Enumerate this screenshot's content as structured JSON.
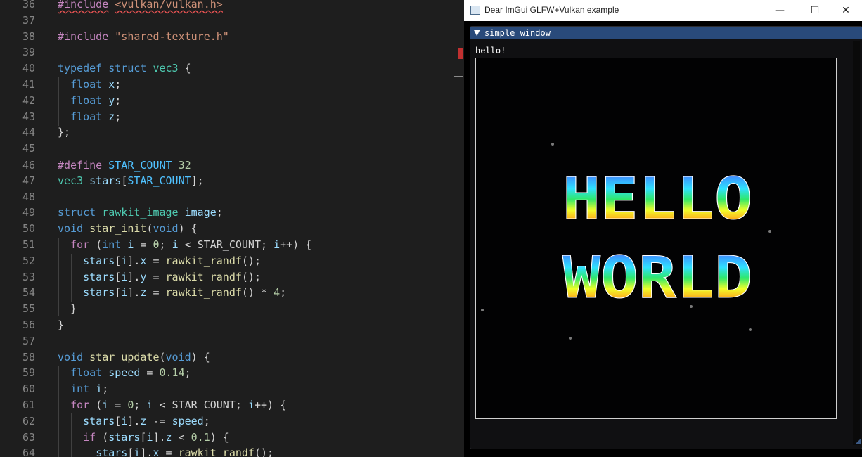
{
  "editor": {
    "lines": [
      {
        "num": "36",
        "tokens": [
          {
            "t": "#include",
            "c": "t-pp squig"
          },
          {
            "t": " ",
            "c": "t-plain"
          },
          {
            "t": "<vulkan/vulkan.h>",
            "c": "t-str squig"
          }
        ]
      },
      {
        "num": "37",
        "tokens": []
      },
      {
        "num": "38",
        "tokens": [
          {
            "t": "#include",
            "c": "t-pp"
          },
          {
            "t": " ",
            "c": "t-plain"
          },
          {
            "t": "\"shared-texture.h\"",
            "c": "t-str"
          }
        ]
      },
      {
        "num": "39",
        "tokens": []
      },
      {
        "num": "40",
        "tokens": [
          {
            "t": "typedef",
            "c": "t-kw"
          },
          {
            "t": " ",
            "c": "t-plain"
          },
          {
            "t": "struct",
            "c": "t-kw"
          },
          {
            "t": " ",
            "c": "t-plain"
          },
          {
            "t": "vec3",
            "c": "t-ty"
          },
          {
            "t": " {",
            "c": "t-plain"
          }
        ]
      },
      {
        "num": "41",
        "tokens": [
          {
            "t": "  ",
            "c": "t-plain"
          },
          {
            "t": "float",
            "c": "t-kw"
          },
          {
            "t": " ",
            "c": "t-plain"
          },
          {
            "t": "x",
            "c": "t-id"
          },
          {
            "t": ";",
            "c": "t-plain"
          }
        ]
      },
      {
        "num": "42",
        "tokens": [
          {
            "t": "  ",
            "c": "t-plain"
          },
          {
            "t": "float",
            "c": "t-kw"
          },
          {
            "t": " ",
            "c": "t-plain"
          },
          {
            "t": "y",
            "c": "t-id"
          },
          {
            "t": ";",
            "c": "t-plain"
          }
        ]
      },
      {
        "num": "43",
        "tokens": [
          {
            "t": "  ",
            "c": "t-plain"
          },
          {
            "t": "float",
            "c": "t-kw"
          },
          {
            "t": " ",
            "c": "t-plain"
          },
          {
            "t": "z",
            "c": "t-id"
          },
          {
            "t": ";",
            "c": "t-plain"
          }
        ]
      },
      {
        "num": "44",
        "tokens": [
          {
            "t": "};",
            "c": "t-plain"
          }
        ]
      },
      {
        "num": "45",
        "tokens": []
      },
      {
        "num": "46",
        "tokens": [
          {
            "t": "#define",
            "c": "t-pp"
          },
          {
            "t": " ",
            "c": "t-plain"
          },
          {
            "t": "STAR_COUNT",
            "c": "t-mac"
          },
          {
            "t": " ",
            "c": "t-plain"
          },
          {
            "t": "32",
            "c": "t-num"
          }
        ]
      },
      {
        "num": "47",
        "tokens": [
          {
            "t": "vec3",
            "c": "t-ty"
          },
          {
            "t": " ",
            "c": "t-plain"
          },
          {
            "t": "stars",
            "c": "t-id"
          },
          {
            "t": "[",
            "c": "t-plain"
          },
          {
            "t": "STAR_COUNT",
            "c": "t-mac"
          },
          {
            "t": "];",
            "c": "t-plain"
          }
        ]
      },
      {
        "num": "48",
        "tokens": []
      },
      {
        "num": "49",
        "tokens": [
          {
            "t": "struct",
            "c": "t-kw"
          },
          {
            "t": " ",
            "c": "t-plain"
          },
          {
            "t": "rawkit_image",
            "c": "t-ty"
          },
          {
            "t": " ",
            "c": "t-plain"
          },
          {
            "t": "image",
            "c": "t-id"
          },
          {
            "t": ";",
            "c": "t-plain"
          }
        ]
      },
      {
        "num": "50",
        "tokens": [
          {
            "t": "void",
            "c": "t-kw"
          },
          {
            "t": " ",
            "c": "t-plain"
          },
          {
            "t": "star_init",
            "c": "t-fn"
          },
          {
            "t": "(",
            "c": "t-plain"
          },
          {
            "t": "void",
            "c": "t-kw"
          },
          {
            "t": ") {",
            "c": "t-plain"
          }
        ]
      },
      {
        "num": "51",
        "tokens": [
          {
            "t": "  ",
            "c": "t-plain"
          },
          {
            "t": "for",
            "c": "t-pp"
          },
          {
            "t": " (",
            "c": "t-plain"
          },
          {
            "t": "int",
            "c": "t-kw"
          },
          {
            "t": " ",
            "c": "t-plain"
          },
          {
            "t": "i",
            "c": "t-id"
          },
          {
            "t": " = ",
            "c": "t-plain"
          },
          {
            "t": "0",
            "c": "t-num"
          },
          {
            "t": "; ",
            "c": "t-plain"
          },
          {
            "t": "i",
            "c": "t-id"
          },
          {
            "t": " < ",
            "c": "t-plain"
          },
          {
            "t": "STAR_COUNT",
            "c": "t-plain"
          },
          {
            "t": "; ",
            "c": "t-plain"
          },
          {
            "t": "i",
            "c": "t-id"
          },
          {
            "t": "++) {",
            "c": "t-plain"
          }
        ]
      },
      {
        "num": "52",
        "tokens": [
          {
            "t": "    ",
            "c": "t-plain"
          },
          {
            "t": "stars",
            "c": "t-id"
          },
          {
            "t": "[",
            "c": "t-plain"
          },
          {
            "t": "i",
            "c": "t-id"
          },
          {
            "t": "].",
            "c": "t-plain"
          },
          {
            "t": "x",
            "c": "t-id"
          },
          {
            "t": " = ",
            "c": "t-plain"
          },
          {
            "t": "rawkit_randf",
            "c": "t-fn"
          },
          {
            "t": "();",
            "c": "t-plain"
          }
        ]
      },
      {
        "num": "53",
        "tokens": [
          {
            "t": "    ",
            "c": "t-plain"
          },
          {
            "t": "stars",
            "c": "t-id"
          },
          {
            "t": "[",
            "c": "t-plain"
          },
          {
            "t": "i",
            "c": "t-id"
          },
          {
            "t": "].",
            "c": "t-plain"
          },
          {
            "t": "y",
            "c": "t-id"
          },
          {
            "t": " = ",
            "c": "t-plain"
          },
          {
            "t": "rawkit_randf",
            "c": "t-fn"
          },
          {
            "t": "();",
            "c": "t-plain"
          }
        ]
      },
      {
        "num": "54",
        "tokens": [
          {
            "t": "    ",
            "c": "t-plain"
          },
          {
            "t": "stars",
            "c": "t-id"
          },
          {
            "t": "[",
            "c": "t-plain"
          },
          {
            "t": "i",
            "c": "t-id"
          },
          {
            "t": "].",
            "c": "t-plain"
          },
          {
            "t": "z",
            "c": "t-id"
          },
          {
            "t": " = ",
            "c": "t-plain"
          },
          {
            "t": "rawkit_randf",
            "c": "t-fn"
          },
          {
            "t": "() * ",
            "c": "t-plain"
          },
          {
            "t": "4",
            "c": "t-num"
          },
          {
            "t": ";",
            "c": "t-plain"
          }
        ]
      },
      {
        "num": "55",
        "tokens": [
          {
            "t": "  }",
            "c": "t-plain"
          }
        ]
      },
      {
        "num": "56",
        "tokens": [
          {
            "t": "}",
            "c": "t-plain"
          }
        ]
      },
      {
        "num": "57",
        "tokens": []
      },
      {
        "num": "58",
        "tokens": [
          {
            "t": "void",
            "c": "t-kw"
          },
          {
            "t": " ",
            "c": "t-plain"
          },
          {
            "t": "star_update",
            "c": "t-fn"
          },
          {
            "t": "(",
            "c": "t-plain"
          },
          {
            "t": "void",
            "c": "t-kw"
          },
          {
            "t": ") {",
            "c": "t-plain"
          }
        ]
      },
      {
        "num": "59",
        "tokens": [
          {
            "t": "  ",
            "c": "t-plain"
          },
          {
            "t": "float",
            "c": "t-kw"
          },
          {
            "t": " ",
            "c": "t-plain"
          },
          {
            "t": "speed",
            "c": "t-id"
          },
          {
            "t": " = ",
            "c": "t-plain"
          },
          {
            "t": "0.14",
            "c": "t-num"
          },
          {
            "t": ";",
            "c": "t-plain"
          }
        ]
      },
      {
        "num": "60",
        "tokens": [
          {
            "t": "  ",
            "c": "t-plain"
          },
          {
            "t": "int",
            "c": "t-kw"
          },
          {
            "t": " ",
            "c": "t-plain"
          },
          {
            "t": "i",
            "c": "t-id"
          },
          {
            "t": ";",
            "c": "t-plain"
          }
        ]
      },
      {
        "num": "61",
        "tokens": [
          {
            "t": "  ",
            "c": "t-plain"
          },
          {
            "t": "for",
            "c": "t-pp"
          },
          {
            "t": " (",
            "c": "t-plain"
          },
          {
            "t": "i",
            "c": "t-id"
          },
          {
            "t": " = ",
            "c": "t-plain"
          },
          {
            "t": "0",
            "c": "t-num"
          },
          {
            "t": "; ",
            "c": "t-plain"
          },
          {
            "t": "i",
            "c": "t-id"
          },
          {
            "t": " < ",
            "c": "t-plain"
          },
          {
            "t": "STAR_COUNT",
            "c": "t-plain"
          },
          {
            "t": "; ",
            "c": "t-plain"
          },
          {
            "t": "i",
            "c": "t-id"
          },
          {
            "t": "++) {",
            "c": "t-plain"
          }
        ]
      },
      {
        "num": "62",
        "tokens": [
          {
            "t": "    ",
            "c": "t-plain"
          },
          {
            "t": "stars",
            "c": "t-id"
          },
          {
            "t": "[",
            "c": "t-plain"
          },
          {
            "t": "i",
            "c": "t-id"
          },
          {
            "t": "].",
            "c": "t-plain"
          },
          {
            "t": "z",
            "c": "t-id"
          },
          {
            "t": " -= ",
            "c": "t-plain"
          },
          {
            "t": "speed",
            "c": "t-id"
          },
          {
            "t": ";",
            "c": "t-plain"
          }
        ]
      },
      {
        "num": "63",
        "tokens": [
          {
            "t": "    ",
            "c": "t-plain"
          },
          {
            "t": "if",
            "c": "t-pp"
          },
          {
            "t": " (",
            "c": "t-plain"
          },
          {
            "t": "stars",
            "c": "t-id"
          },
          {
            "t": "[",
            "c": "t-plain"
          },
          {
            "t": "i",
            "c": "t-id"
          },
          {
            "t": "].",
            "c": "t-plain"
          },
          {
            "t": "z",
            "c": "t-id"
          },
          {
            "t": " < ",
            "c": "t-plain"
          },
          {
            "t": "0.1",
            "c": "t-num"
          },
          {
            "t": ") {",
            "c": "t-plain"
          }
        ]
      },
      {
        "num": "64",
        "tokens": [
          {
            "t": "      ",
            "c": "t-plain"
          },
          {
            "t": "stars",
            "c": "t-id"
          },
          {
            "t": "[",
            "c": "t-plain"
          },
          {
            "t": "i",
            "c": "t-id"
          },
          {
            "t": "].",
            "c": "t-plain"
          },
          {
            "t": "x",
            "c": "t-id"
          },
          {
            "t": " = ",
            "c": "t-plain"
          },
          {
            "t": "rawkit_randf",
            "c": "t-fn"
          },
          {
            "t": "();",
            "c": "t-plain"
          }
        ]
      }
    ]
  },
  "window": {
    "title": "Dear ImGui GLFW+Vulkan example",
    "minimize_glyph": "—",
    "maximize_glyph": "☐",
    "close_glyph": "✕",
    "icon": "app-window-icon"
  },
  "imgui": {
    "collapse_glyph": "▼",
    "window_title": "simple window",
    "text": "hello!",
    "banner_lines": [
      "HELLO",
      "WORLD"
    ],
    "banner_colors": [
      "#ff3bd0",
      "#3a9bff",
      "#2fe0ff",
      "#2fe86a",
      "#f0ff2a",
      "#ff9f1a",
      "#ff3030"
    ]
  }
}
